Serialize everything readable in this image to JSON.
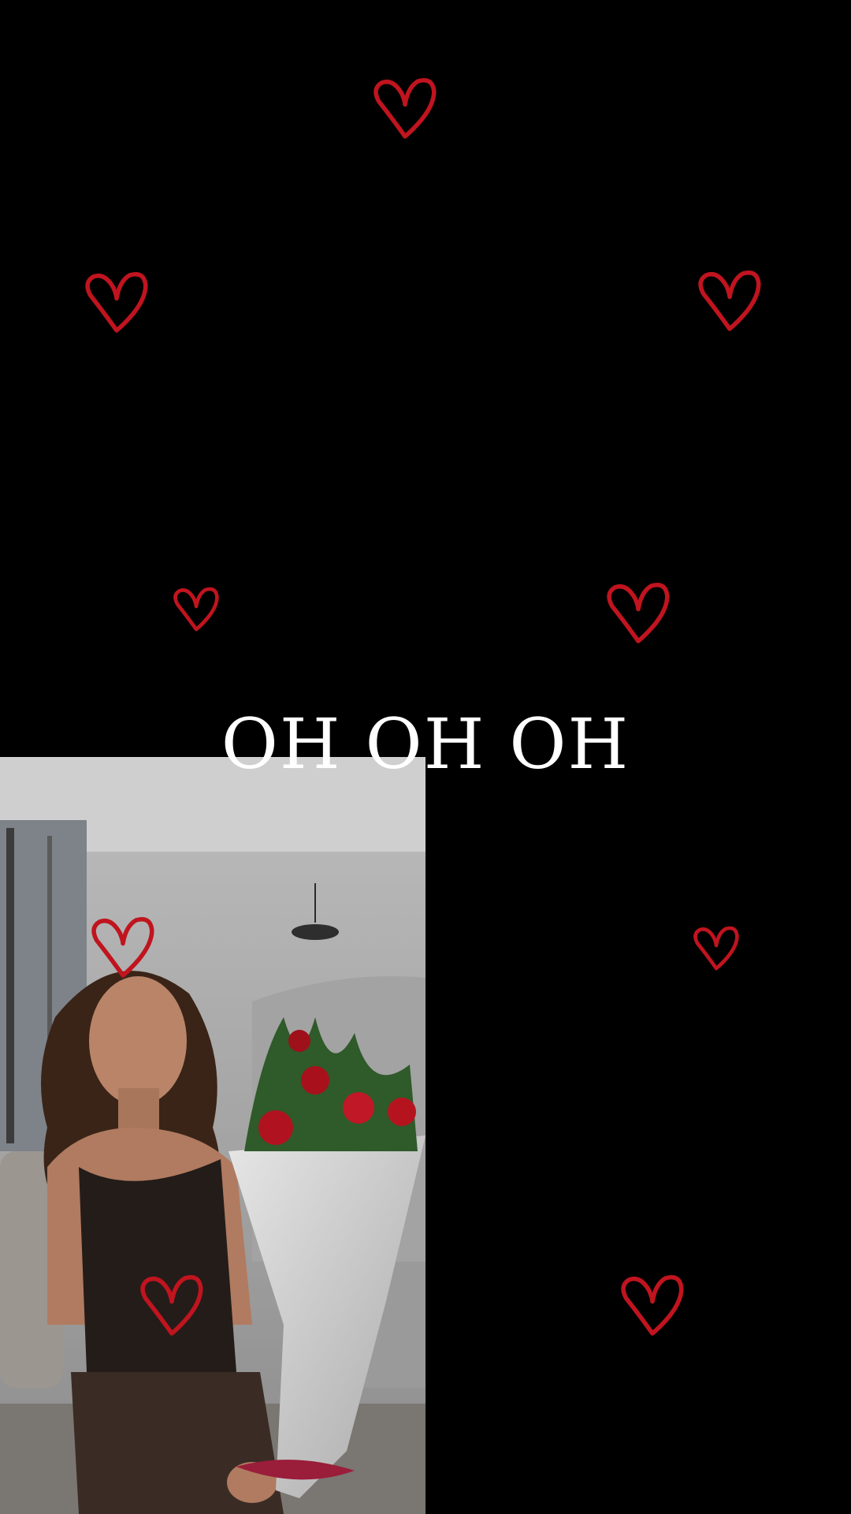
{
  "caption": {
    "text": "OH OH OH",
    "color": "#ffffff"
  },
  "theme": {
    "background": "#000000",
    "heart_color": "#c0141f"
  },
  "icons": {
    "heart": "heart-outline-icon"
  },
  "video": {
    "subject": "woman-holding-rose-bouquet"
  }
}
